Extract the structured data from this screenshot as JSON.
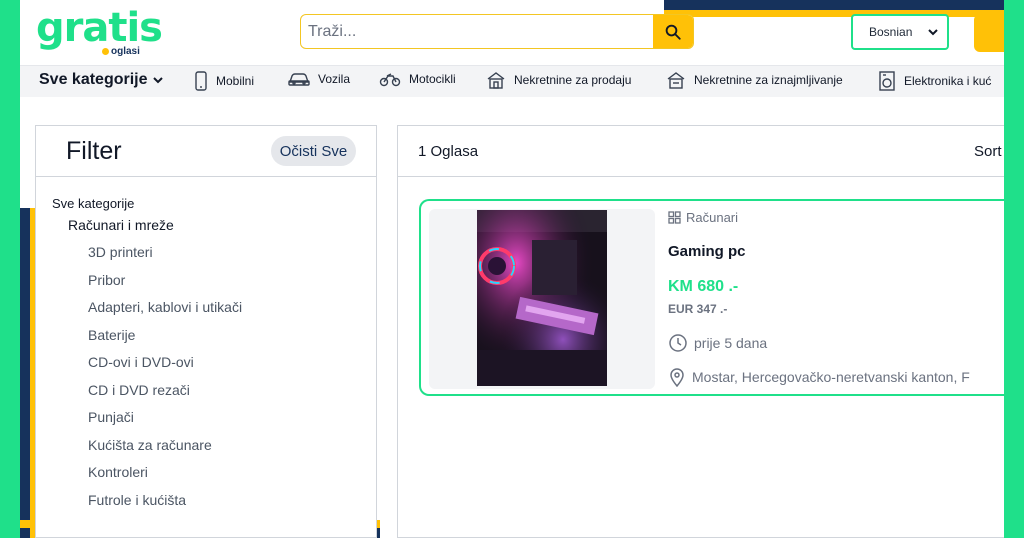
{
  "brand": {
    "name": "gratis",
    "sub": "oglasi",
    "color": "#1fe08a"
  },
  "search": {
    "placeholder": "Traži..."
  },
  "language": {
    "selected": "Bosnian"
  },
  "categories": {
    "all_label": "Sve kategorije",
    "items": [
      {
        "label": "Mobilni",
        "icon": "phone-icon"
      },
      {
        "label": "Vozila",
        "icon": "car-icon"
      },
      {
        "label": "Motocikli",
        "icon": "motorcycle-icon"
      },
      {
        "label": "Nekretnine za prodaju",
        "icon": "house-icon"
      },
      {
        "label": "Nekretnine za iznajmljivanje",
        "icon": "house-rent-icon"
      },
      {
        "label": "Elektronika i kuć",
        "icon": "appliance-icon"
      }
    ]
  },
  "filter": {
    "title": "Filter",
    "clear_label": "Očisti Sve",
    "root": "Sve kategorije",
    "subcategory": "Računari i mreže",
    "items": [
      "3D printeri",
      "Pribor",
      "Adapteri, kablovi i utikači",
      "Baterije",
      "CD-ovi i DVD-ovi",
      "CD i DVD rezači",
      "Punjači",
      "Kućišta za računare",
      "Kontroleri",
      "Futrole i kućišta"
    ]
  },
  "results": {
    "count_label": "1 Oglasa",
    "sort_label": "Sort"
  },
  "listing": {
    "category": "Računari",
    "title": "Gaming pc",
    "price": "KM 680 .-",
    "price_eur": "EUR 347 .-",
    "time": "prije 5 dana",
    "location": "Mostar, Hercegovačko-neretvanski kanton, F"
  },
  "colors": {
    "accent": "#1fe08a",
    "yellow": "#ffc107",
    "navy": "#16325c"
  }
}
